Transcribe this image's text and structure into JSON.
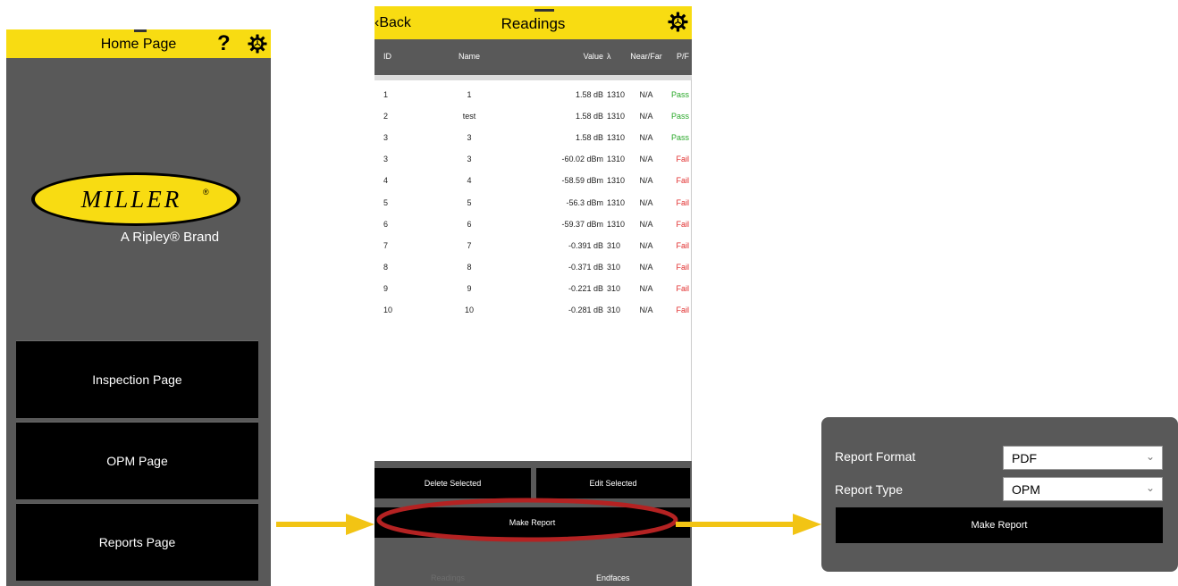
{
  "home": {
    "title": "Home Page",
    "help_label": "?",
    "logo_text": "MILLER",
    "logo_mark": "®",
    "brand": "A Ripley® Brand",
    "buttons": [
      "Inspection Page",
      "OPM Page",
      "Reports Page"
    ]
  },
  "readings": {
    "back_label": "‹Back",
    "title": "Readings",
    "columns": [
      "ID",
      "Name",
      "Value",
      "λ",
      "Near/Far",
      "P/F"
    ],
    "rows": [
      {
        "id": "1",
        "name": "1",
        "value": "1.58 dB",
        "lambda": "1310",
        "nf": "N/A",
        "pf": "Pass"
      },
      {
        "id": "2",
        "name": "test",
        "value": "1.58 dB",
        "lambda": "1310",
        "nf": "N/A",
        "pf": "Pass"
      },
      {
        "id": "3",
        "name": "3",
        "value": "1.58 dB",
        "lambda": "1310",
        "nf": "N/A",
        "pf": "Pass"
      },
      {
        "id": "3",
        "name": "3",
        "value": "-60.02 dBm",
        "lambda": "1310",
        "nf": "N/A",
        "pf": "Fail"
      },
      {
        "id": "4",
        "name": "4",
        "value": "-58.59 dBm",
        "lambda": "1310",
        "nf": "N/A",
        "pf": "Fail"
      },
      {
        "id": "5",
        "name": "5",
        "value": "-56.3 dBm",
        "lambda": "1310",
        "nf": "N/A",
        "pf": "Fail"
      },
      {
        "id": "6",
        "name": "6",
        "value": "-59.37 dBm",
        "lambda": "1310",
        "nf": "N/A",
        "pf": "Fail"
      },
      {
        "id": "7",
        "name": "7",
        "value": "-0.391 dB",
        "lambda": "310",
        "nf": "N/A",
        "pf": "Fail"
      },
      {
        "id": "8",
        "name": "8",
        "value": "-0.371 dB",
        "lambda": "310",
        "nf": "N/A",
        "pf": "Fail"
      },
      {
        "id": "9",
        "name": "9",
        "value": "-0.221 dB",
        "lambda": "310",
        "nf": "N/A",
        "pf": "Fail"
      },
      {
        "id": "10",
        "name": "10",
        "value": "-0.281 dB",
        "lambda": "310",
        "nf": "N/A",
        "pf": "Fail"
      }
    ],
    "delete_label": "Delete Selected",
    "edit_label": "Edit Selected",
    "make_report_label": "Make Report",
    "tabs": [
      "Readings",
      "Endfaces"
    ]
  },
  "report": {
    "format_label": "Report Format",
    "format_value": "PDF",
    "type_label": "Report Type",
    "type_value": "OPM",
    "make_report_label": "Make Report"
  },
  "colors": {
    "accent_yellow": "#f8dc12",
    "panel_gray": "#595959",
    "highlight_red": "#b42222",
    "pass_green": "#2aa82a",
    "fail_red": "#e12b2b"
  },
  "icons": [
    "gear-icon",
    "help-icon",
    "chevron-down-icon",
    "arrow-right-icon"
  ]
}
